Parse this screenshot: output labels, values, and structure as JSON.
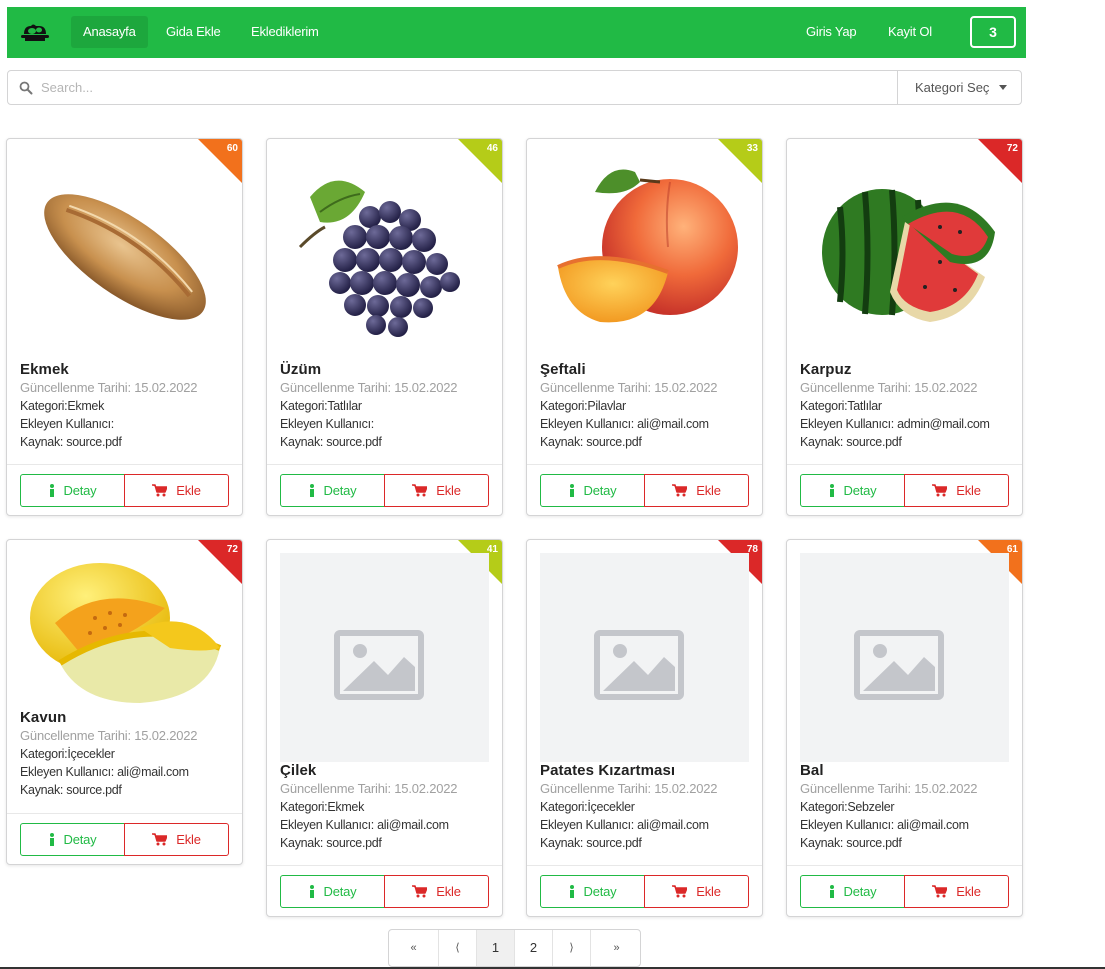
{
  "nav": {
    "items": [
      "Anasayfa",
      "Gida Ekle",
      "Eklediklerim"
    ],
    "login": "Giris Yap",
    "register": "Kayit Ol",
    "cart_count": "3"
  },
  "search": {
    "placeholder": "Search...",
    "category_label": "Kategori Seç"
  },
  "card_labels": {
    "detay": "Detay",
    "ekle": "Ekle"
  },
  "cards": [
    {
      "name": "Ekmek",
      "date": "Güncellenme Tarihi: 15.02.2022",
      "category": "Kategori:Ekmek",
      "user": "Ekleyen Kullanıcı:",
      "source": "Kaynak: source.pdf",
      "badge": "60",
      "badge_color": "#f2711c",
      "image": "bread"
    },
    {
      "name": "Üzüm",
      "date": "Güncellenme Tarihi: 15.02.2022",
      "category": "Kategori:Tatlılar",
      "user": "Ekleyen Kullanıcı:",
      "source": "Kaynak: source.pdf",
      "badge": "46",
      "badge_color": "#b5cc18",
      "image": "grapes"
    },
    {
      "name": "Şeftali",
      "date": "Güncellenme Tarihi: 15.02.2022",
      "category": "Kategori:Pilavlar",
      "user": "Ekleyen Kullanıcı: ali@mail.com",
      "source": "Kaynak: source.pdf",
      "badge": "33",
      "badge_color": "#b5cc18",
      "image": "peach"
    },
    {
      "name": "Karpuz",
      "date": "Güncellenme Tarihi: 15.02.2022",
      "category": "Kategori:Tatlılar",
      "user": "Ekleyen Kullanıcı: admin@mail.com",
      "source": "Kaynak: source.pdf",
      "badge": "72",
      "badge_color": "#db2828",
      "image": "watermelon"
    },
    {
      "name": "Kavun",
      "date": "Güncellenme Tarihi: 15.02.2022",
      "category": "Kategori:İçecekler",
      "user": "Ekleyen Kullanıcı: ali@mail.com",
      "source": "Kaynak: source.pdf",
      "badge": "72",
      "badge_color": "#db2828",
      "image": "melon"
    },
    {
      "name": "Çilek",
      "date": "Güncellenme Tarihi: 15.02.2022",
      "category": "Kategori:Ekmek",
      "user": "Ekleyen Kullanıcı: ali@mail.com",
      "source": "Kaynak: source.pdf",
      "badge": "41",
      "badge_color": "#b5cc18",
      "image": "placeholder"
    },
    {
      "name": "Patates Kızartması",
      "date": "Güncellenme Tarihi: 15.02.2022",
      "category": "Kategori:İçecekler",
      "user": "Ekleyen Kullanıcı: ali@mail.com",
      "source": "Kaynak: source.pdf",
      "badge": "78",
      "badge_color": "#db2828",
      "image": "placeholder"
    },
    {
      "name": "Bal",
      "date": "Güncellenme Tarihi: 15.02.2022",
      "category": "Kategori:Sebzeler",
      "user": "Ekleyen Kullanıcı: ali@mail.com",
      "source": "Kaynak: source.pdf",
      "badge": "61",
      "badge_color": "#f2711c",
      "image": "placeholder"
    }
  ],
  "pagination": {
    "first": "«",
    "prev": "⟨",
    "pages": [
      "1",
      "2"
    ],
    "active": "1",
    "next": "⟩",
    "last": "»"
  },
  "colors": {
    "brand": "#21ba45",
    "danger": "#db2828"
  }
}
